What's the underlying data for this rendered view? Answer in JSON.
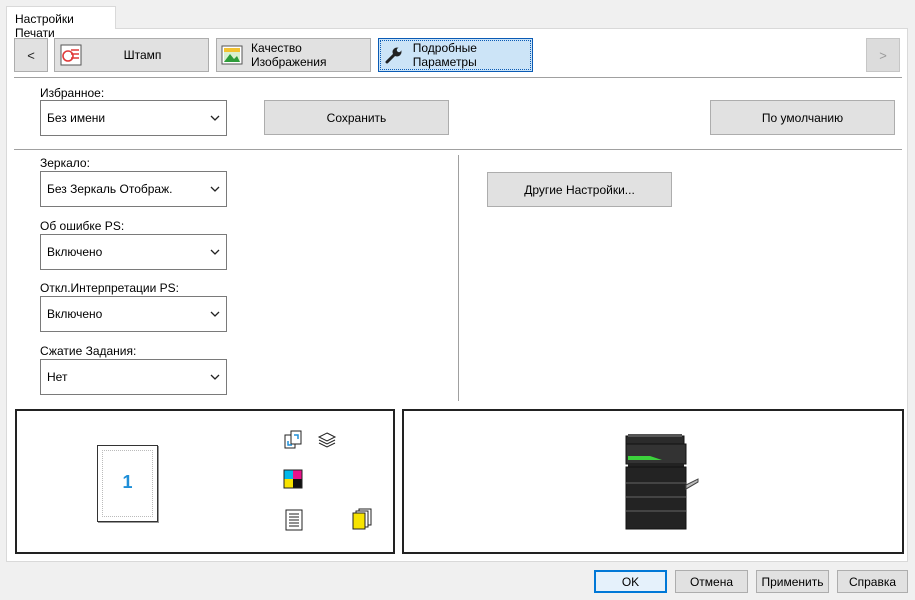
{
  "tab_title": "Настройки Печати",
  "toolbar": {
    "prev_label": "<",
    "next_label": ">",
    "buttons": [
      {
        "label": "Штамп",
        "icon": "stamp-icon"
      },
      {
        "label": "Качество Изображения",
        "icon": "image-quality-icon"
      },
      {
        "label": "Подробные Параметры",
        "icon": "wrench-icon"
      }
    ]
  },
  "favorites": {
    "label": "Избранное:",
    "value": "Без имени",
    "save_label": "Сохранить",
    "default_label": "По умолчанию"
  },
  "settings": {
    "mirror": {
      "label": "Зеркало:",
      "value": "Без Зеркаль Отображ."
    },
    "ps_error": {
      "label": "Об ошибке PS:",
      "value": "Включено"
    },
    "ps_interp": {
      "label": "Откл.Интерпретации PS:",
      "value": "Включено"
    },
    "compress": {
      "label": "Сжатие Задания:",
      "value": "Нет"
    },
    "other_label": "Другие Настройки..."
  },
  "preview": {
    "page_number": "1"
  },
  "footer": {
    "ok": "OK",
    "cancel": "Отмена",
    "apply": "Применить",
    "help": "Справка"
  },
  "colors": {
    "accent": "#0078d7",
    "page_number": "#1f8fd8",
    "active_tab_bg": "#cce4f7"
  }
}
